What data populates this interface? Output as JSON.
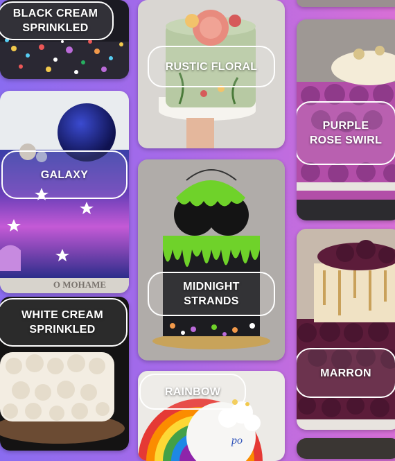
{
  "gallery": {
    "cakes": [
      {
        "id": "black-cream-sprinkled",
        "label": "BLACK CREAM\nSPRINKLED"
      },
      {
        "id": "galaxy",
        "label": "GALAXY"
      },
      {
        "id": "white-cream-sprinkled",
        "label": "WHITE CREAM\nSPRINKLED"
      },
      {
        "id": "rustic-floral",
        "label": "RUSTIC FLORAL"
      },
      {
        "id": "midnight-strands",
        "label": "MIDNIGHT\nSTRANDS"
      },
      {
        "id": "rainbow",
        "label": "RAINBOW"
      },
      {
        "id": "purple-rose-swirl",
        "label": "PURPLE\nROSE SWIRL"
      },
      {
        "id": "marron",
        "label": "MARRON"
      }
    ],
    "galaxy_plate_text": "O MOHAME"
  },
  "colors": {
    "gradient_left": "#8a6cf0",
    "gradient_right": "#d86fd6",
    "label_border": "#ffffff"
  }
}
